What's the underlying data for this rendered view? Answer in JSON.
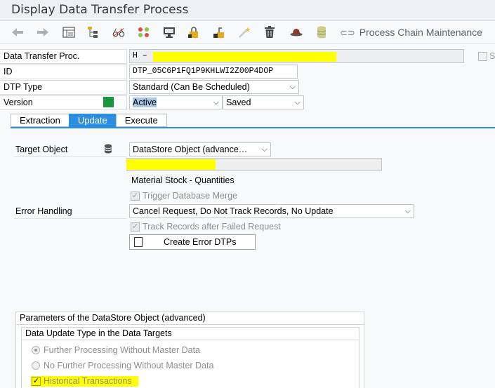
{
  "window": {
    "title": "Display Data Transfer Process"
  },
  "toolbar": {
    "icons": [
      "back-arrow-icon",
      "forward-arrow-icon",
      "details-icon",
      "hierarchy-icon",
      "glasses-icon",
      "dots-icon",
      "monitor-icon",
      "lock-icon",
      "transport-icon",
      "magic-wand-icon",
      "trash-icon",
      "hat-icon",
      "database-icon"
    ],
    "process_chain_label": "Process Chain Maintenance"
  },
  "header": {
    "dtp_label": "Data Transfer Proc.",
    "dtp_value": "H  –",
    "id_label": "ID",
    "id_value": "DTP_05C6P1FQ1P9KHLWI2Z00P4DOP",
    "dtp_type_label": "DTP Type",
    "dtp_type_value": "Standard (Can Be Scheduled)",
    "version_label": "Version",
    "version_value": "Active",
    "version_status": "Saved",
    "side_checkbox_label": "Sa",
    "status_color": "#1a9641"
  },
  "tabs": [
    "Extraction",
    "Update",
    "Execute"
  ],
  "update": {
    "target_object_label": "Target Object",
    "target_object_value": "DataStore Object (advance…",
    "target_description": "Material Stock - Quantities",
    "trigger_merge_label": "Trigger Database Merge",
    "error_handling_label": "Error Handling",
    "error_handling_value": "Cancel Request, Do Not Track Records, No Update",
    "track_records_label": "Track Records after Failed Request",
    "create_error_dtps_label": "Create Error DTPs",
    "params_title": "Parameters of the DataStore Object (advanced)",
    "data_update_title": "Data Update Type in the Data Targets",
    "radio_further": "Further Processing Without Master Data",
    "radio_no_further": "No Further Processing Without Master Data",
    "historical_label": "Historical Transactions"
  },
  "colors": {
    "accent": "#2b8ee0",
    "highlight": "#ffff00"
  }
}
